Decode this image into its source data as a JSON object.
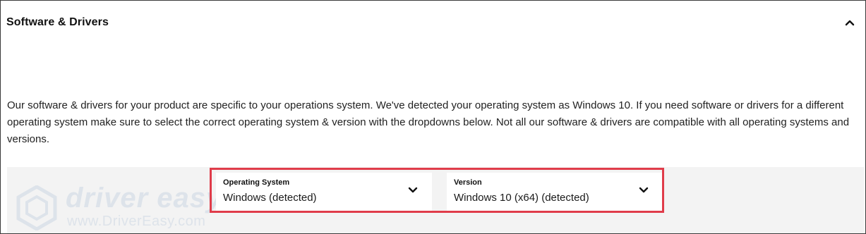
{
  "section": {
    "title": "Software & Drivers",
    "description": "Our software & drivers for your product are specific to your operations system. We've detected your operating system as Windows 10. If you need software or drivers for a different operating system make sure to select the correct operating system & version with the dropdowns below. Not all our software & drivers are compatible with all operating systems and versions."
  },
  "os_dropdown": {
    "label": "Operating System",
    "value": "Windows (detected)"
  },
  "version_dropdown": {
    "label": "Version",
    "value": "Windows 10 (x64) (detected)"
  },
  "watermark": {
    "brand": "driver easy",
    "url": "www.DriverEasy.com"
  },
  "icons": {
    "toggle": "chevron-up-icon",
    "dropdown": "chevron-down-icon"
  },
  "colors": {
    "highlight": "#e03c4a",
    "band": "#f3f3f3",
    "border": "#3a3a3a",
    "watermark": "#dde3ea"
  }
}
